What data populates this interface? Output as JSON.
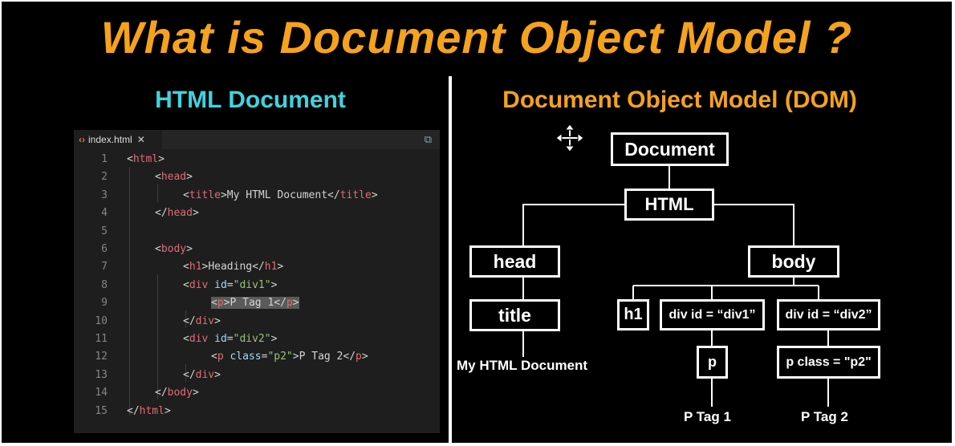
{
  "title": "What is Document Object Model ?",
  "left_heading": "HTML Document",
  "right_heading": "Document Object Model (DOM)",
  "editor": {
    "tab": "index.html",
    "line_numbers": [
      "1",
      "2",
      "3",
      "4",
      "5",
      "6",
      "7",
      "8",
      "9",
      "10",
      "11",
      "12",
      "13",
      "14",
      "15"
    ],
    "lines": [
      "<html>",
      "<head>",
      "<title>My HTML Document</title>",
      "</head>",
      "",
      "<body>",
      "<h1>Heading</h1>",
      "<div id=\"div1\">",
      "<p>P Tag 1</p>",
      "</div>",
      "<div id=\"div2\">",
      "<p class=\"p2\">P Tag 2</p>",
      "</div>",
      "</body>",
      "</html>"
    ]
  },
  "dom": {
    "document": "Document",
    "html": "HTML",
    "head": "head",
    "body": "body",
    "title": "title",
    "h1": "h1",
    "div1": "div id = “div1”",
    "div2": "div id = “div2”",
    "p1": "p",
    "p2": "p class = \"p2\"",
    "title_text": "My HTML Document",
    "p1_text": "P Tag 1",
    "p2_text": "P Tag 2"
  },
  "colors": {
    "title": "#f5a21c",
    "left_heading": "#3fd3e0",
    "right_heading": "#f5a21c"
  }
}
